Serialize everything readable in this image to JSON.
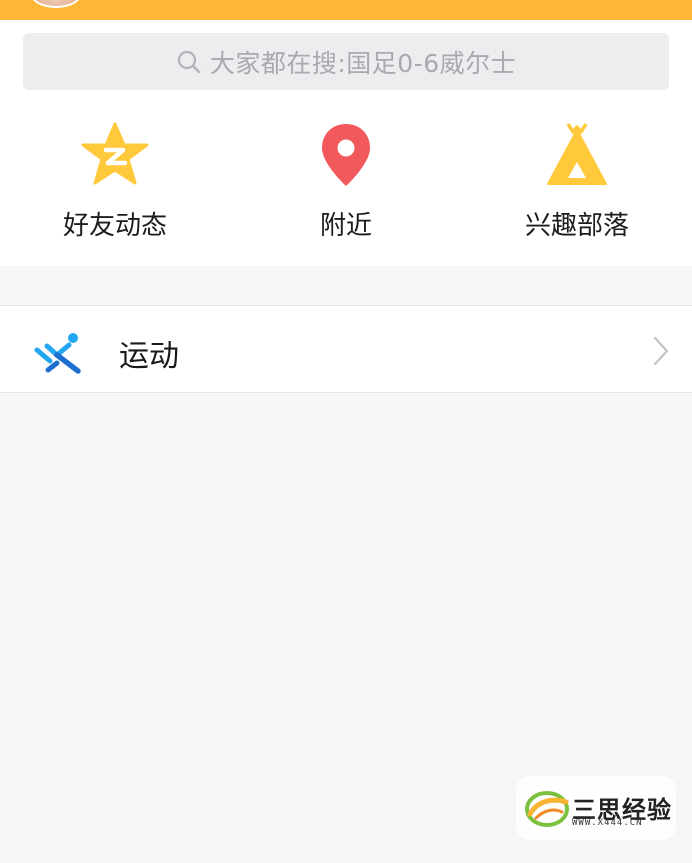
{
  "search": {
    "placeholder": "大家都在搜:国足0-6威尔士",
    "icon": "search-icon"
  },
  "entries": [
    {
      "label": "好友动态",
      "icon": "qzone-star-icon",
      "color": "#ffc93b"
    },
    {
      "label": "附近",
      "icon": "location-pin-icon",
      "color": "#f2595c"
    },
    {
      "label": "兴趣部落",
      "icon": "tent-icon",
      "color": "#ffc93b"
    }
  ],
  "list": [
    {
      "label": "运动",
      "icon": "running-icon",
      "color": "#23a7f2"
    }
  ],
  "watermark": {
    "title": "三思经验",
    "url": "WWW.X444.CN"
  },
  "colors": {
    "top_bar": "#ffb735",
    "background": "#f6f6f9",
    "search_bg": "#ededf0"
  }
}
